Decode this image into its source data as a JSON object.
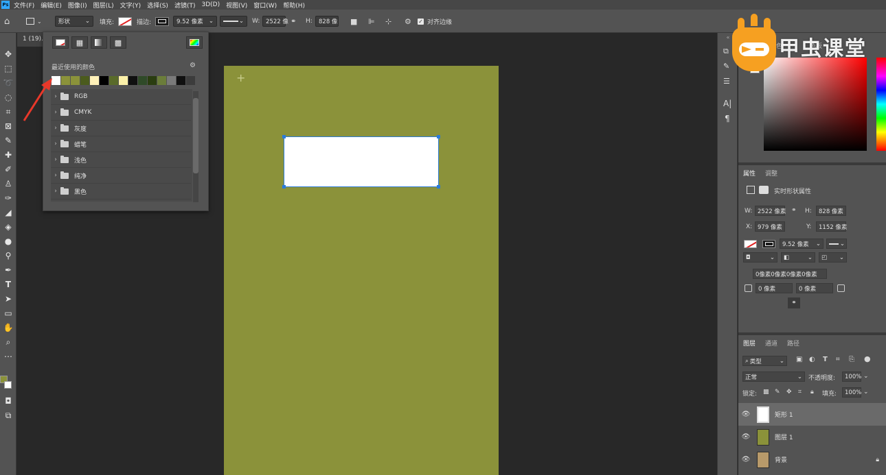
{
  "menubar": {
    "logo": "Ps",
    "items": [
      "文件(F)",
      "编辑(E)",
      "图像(I)",
      "图层(L)",
      "文字(Y)",
      "选择(S)",
      "滤镜(T)",
      "3D(D)",
      "视图(V)",
      "窗口(W)",
      "帮助(H)"
    ]
  },
  "options": {
    "mode": "形状",
    "fill_label": "填充:",
    "stroke_label": "描边:",
    "stroke_width": "9.52 像素",
    "w_label": "W:",
    "w_value": "2522 像",
    "h_label": "H:",
    "h_value": "828 像",
    "align_edges": "对齐边缘"
  },
  "document": {
    "tab_title": "1 (19).j"
  },
  "swatch_panel": {
    "recent_label": "最近使用的颜色",
    "recent_colors": [
      "#ffffff",
      "#8b923a",
      "#8b923a",
      "#4b5b1d",
      "#fff1b8",
      "#000000",
      "#5a6b2a",
      "#fbf0a8",
      "#101010",
      "#2f4a28",
      "#2a3d10",
      "#6b7d3a",
      "#7a7a7a",
      "#101010",
      "#3c3c3c"
    ],
    "folders": [
      "RGB",
      "CMYK",
      "灰度",
      "蜡笔",
      "浅色",
      "纯净",
      "黑色"
    ]
  },
  "watermark": {
    "brand": "甲虫课堂"
  },
  "color_panel": {
    "tabs": [
      "颜色",
      "色板"
    ]
  },
  "properties": {
    "tabs": [
      "属性",
      "调整"
    ],
    "section_title": "实时形状属性",
    "w_label": "W:",
    "w_value": "2522 像素",
    "h_label": "H:",
    "h_value": "828 像素",
    "x_label": "X:",
    "x_value": "979 像素",
    "y_label": "Y:",
    "y_value": "1152 像素",
    "stroke_width": "9.52 像素",
    "corner_summary": "0像素0像素0像素0像素",
    "corner_tl": "0 像素",
    "corner_tr": "0 像素"
  },
  "layers": {
    "tabs": [
      "图层",
      "通道",
      "路径"
    ],
    "filter_kind": "类型",
    "blend_mode": "正常",
    "opacity_label": "不透明度:",
    "opacity_value": "100%",
    "lock_label": "锁定:",
    "fill_label": "填充:",
    "fill_value": "100%",
    "items": [
      {
        "name": "矩形 1",
        "thumb": "#ffffff"
      },
      {
        "name": "图层 1",
        "thumb": "#8b923a"
      },
      {
        "name": "背景",
        "thumb": "#b89a6a"
      }
    ]
  },
  "colors": {
    "canvas": "#8b923a",
    "shape_fill": "#ffffff",
    "selection": "#2b7bd8",
    "foreground": "#8b923a",
    "background": "#ffffff"
  }
}
